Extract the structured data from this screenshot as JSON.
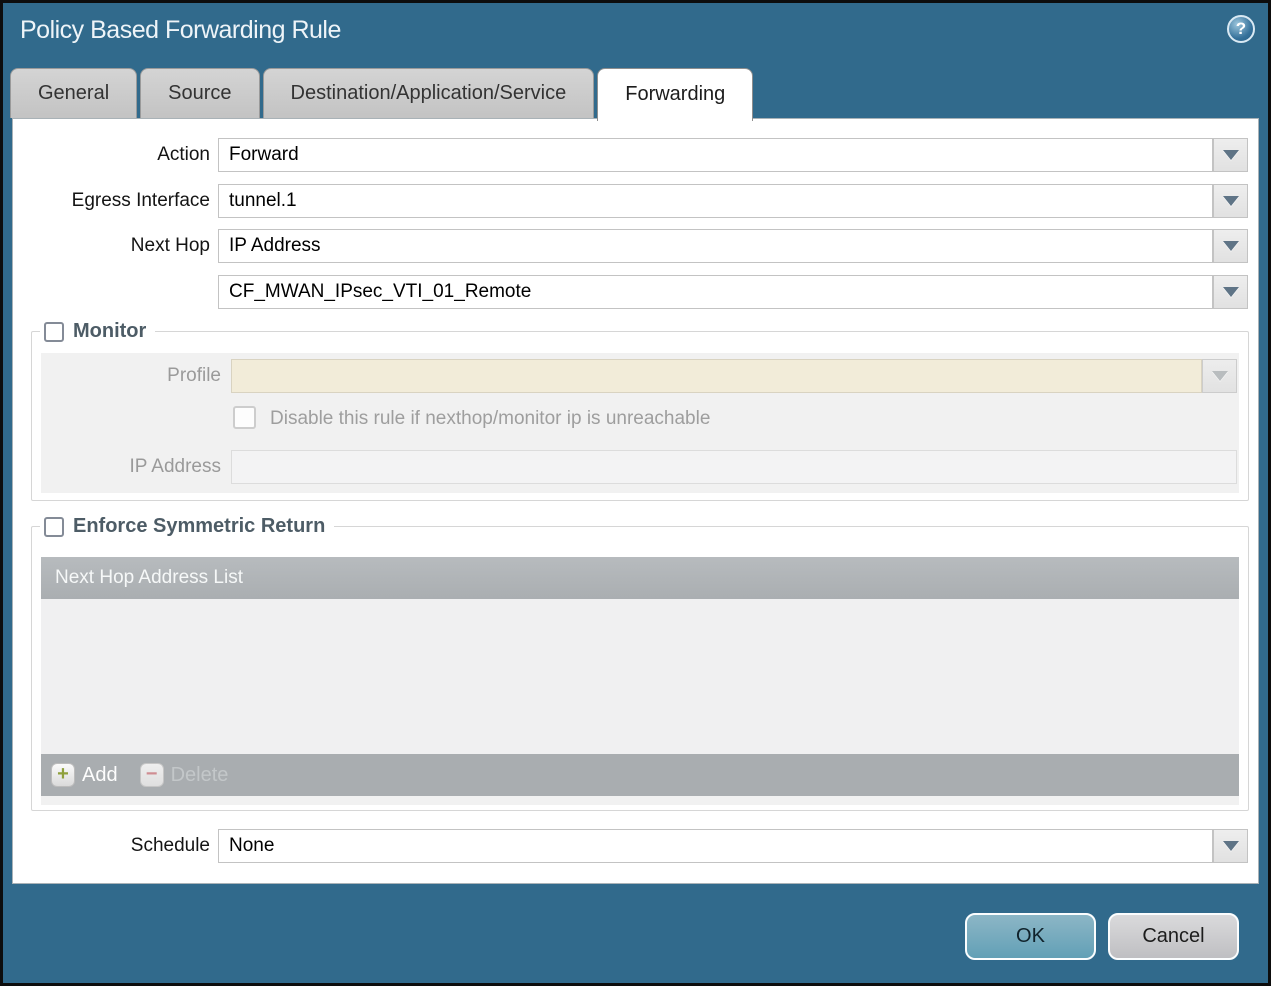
{
  "window": {
    "title": "Policy Based Forwarding Rule"
  },
  "help_icon": {
    "glyph": "?"
  },
  "tabs": [
    {
      "label": "General",
      "active": false
    },
    {
      "label": "Source",
      "active": false
    },
    {
      "label": "Destination/Application/Service",
      "active": false
    },
    {
      "label": "Forwarding",
      "active": true
    }
  ],
  "form": {
    "action": {
      "label": "Action",
      "value": "Forward"
    },
    "egress_interface": {
      "label": "Egress Interface",
      "value": "tunnel.1"
    },
    "next_hop": {
      "label": "Next Hop",
      "value": "IP Address"
    },
    "next_hop_address": {
      "value": "CF_MWAN_IPsec_VTI_01_Remote"
    },
    "schedule": {
      "label": "Schedule",
      "value": "None"
    }
  },
  "monitor": {
    "legend": "Monitor",
    "checked": false,
    "profile": {
      "label": "Profile",
      "value": ""
    },
    "disable_rule": {
      "label": "Disable this rule if nexthop/monitor ip is unreachable",
      "checked": false
    },
    "ip_address": {
      "label": "IP Address",
      "value": ""
    }
  },
  "enforce_symmetric_return": {
    "legend": "Enforce Symmetric Return",
    "checked": false,
    "table": {
      "header": "Next Hop Address List",
      "rows": []
    },
    "add_button": {
      "label": "Add",
      "glyph": "+",
      "enabled": true
    },
    "delete_button": {
      "label": "Delete",
      "glyph": "−",
      "enabled": false
    }
  },
  "dialog_buttons": {
    "ok": "OK",
    "cancel": "Cancel"
  },
  "colors": {
    "titlebar_teal": "#316a8c",
    "active_tab_bg": "#ffffff",
    "inactive_tab_bg": "#c9c9c9",
    "disabled_field_beige": "#f2ecd9",
    "table_header_gray": "#b1b5b8",
    "table_footer_gray": "#a9adb0",
    "ok_button_blue": "#6ba3b8",
    "cancel_button_gray": "#c9c9cb",
    "add_plus_green": "#8fa03c",
    "delete_minus_red": "#cf8d92"
  }
}
